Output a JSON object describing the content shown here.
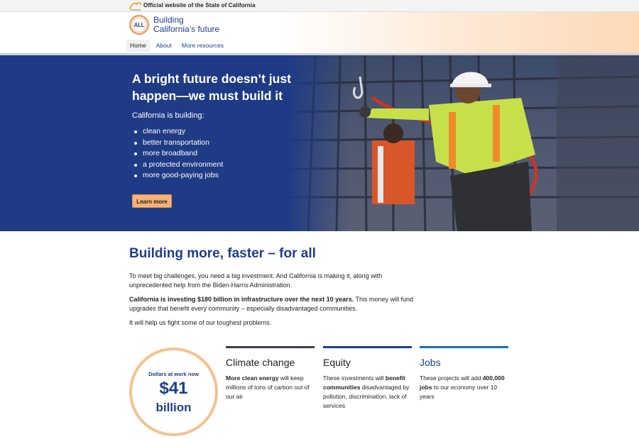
{
  "gov_banner": {
    "text": "Official website of the State of California"
  },
  "header": {
    "logo_text": "ALL",
    "title_line1": "Building",
    "title_line2": "California’s future"
  },
  "nav": [
    {
      "label": "Home",
      "active": true
    },
    {
      "label": "About"
    },
    {
      "label": "More resources"
    }
  ],
  "hero": {
    "title": "A bright future doesn’t just happen—we must build it",
    "intro": "California is building:",
    "list": [
      "clean energy",
      "better transportation",
      "more broadband",
      "a protected environment",
      "more good-paying jobs"
    ],
    "button": "Learn more"
  },
  "main": {
    "title": "Building more, faster – for all",
    "p1": "To meet big challenges, you need a big investment. And California is making it, along with unprecedented help from the Biden-Harris Administration.",
    "p2_bold": "California is investing $180 billion in infrastructure over the next 10 years.",
    "p2_rest": " This money will fund upgrades that benefit every community – especially disadvantaged communities.",
    "p3": "It will help us fight some of our toughest problems."
  },
  "stat": {
    "label": "Dollars at work now",
    "value": "$41",
    "unit": "billion"
  },
  "columns": [
    {
      "title": "Climate change",
      "color": "#3d3d4a",
      "bold": "More clean energy",
      "rest": " will keep millions of tons of carbon out of our air"
    },
    {
      "title": "Equity",
      "color": "#1f3e8a",
      "pre": "These investments will ",
      "bold": "benefit communities",
      "rest": " disadvantaged by pollution, discrimination, lack of services"
    },
    {
      "title": "Jobs",
      "color": "#1f6fae",
      "pre": "These projects will add ",
      "bold": "400,000 jobs",
      "rest": " to our economy over 10 years"
    }
  ],
  "colors": {
    "primary": "#1f3e8a",
    "hero_bg": "#1f3b85",
    "accent": "#f6b278"
  }
}
